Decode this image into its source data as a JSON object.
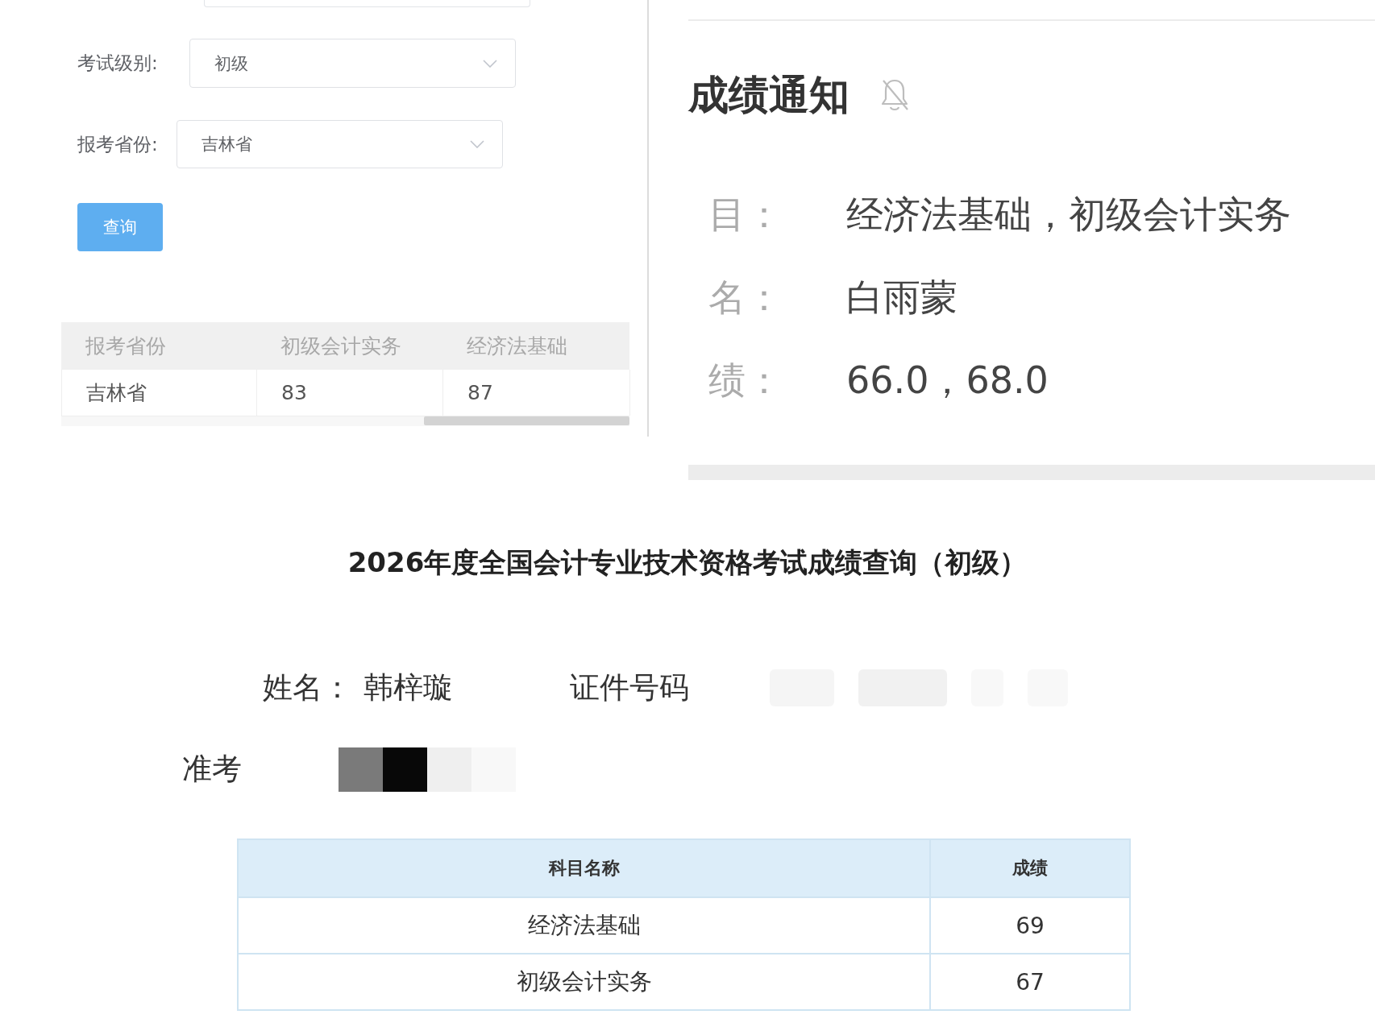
{
  "query_form": {
    "fields": [
      {
        "label": "考试级别:",
        "value": "初级"
      },
      {
        "label": "报考省份:",
        "value": "吉林省"
      }
    ],
    "button": "查询"
  },
  "province_table": {
    "columns": [
      "报考省份",
      "初级会计实务",
      "经济法基础"
    ],
    "rows": [
      [
        "吉林省",
        "83",
        "87"
      ]
    ]
  },
  "notification": {
    "title": "成绩通知",
    "rows": [
      {
        "label": "目：",
        "value": "经济法基础，初级会计实务"
      },
      {
        "label": "名：",
        "value": "白雨蒙"
      },
      {
        "label": "绩：",
        "value": "66.0，68.0"
      }
    ]
  },
  "result_page": {
    "title": "2026年度全国会计专业技术资格考试成绩查询（初级）",
    "name": {
      "label": "姓名：",
      "value": "韩梓璇"
    },
    "id_number": {
      "label": "证件号码"
    },
    "admission_ticket": {
      "label": "准考"
    },
    "table": {
      "columns": [
        "科目名称",
        "成绩"
      ],
      "rows": [
        [
          "经济法基础",
          "69"
        ],
        [
          "初级会计实务",
          "67"
        ]
      ]
    }
  }
}
